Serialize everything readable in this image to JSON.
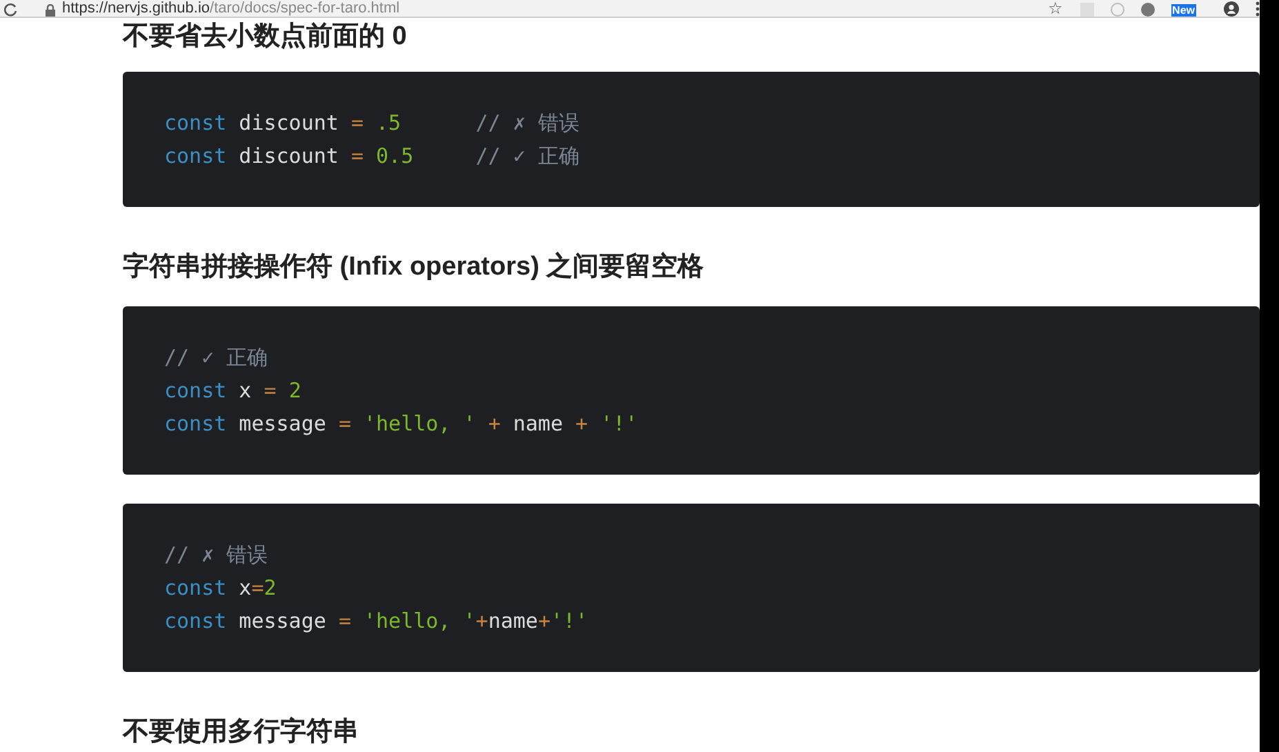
{
  "browser": {
    "url_host": "https://nervjs.github.io",
    "url_path": "/taro/docs/spec-for-taro.html",
    "star": "☆",
    "badge": "New"
  },
  "sections": [
    {
      "heading": "不要省去小数点前面的 0",
      "blocks": [
        {
          "lines": [
            [
              {
                "kind": "keyword",
                "text": "const"
              },
              {
                "kind": "plain",
                "text": " discount "
              },
              {
                "kind": "operator",
                "text": "= "
              },
              {
                "kind": "number",
                "text": ".5"
              },
              {
                "kind": "comment",
                "text": "      // ✗ 错误"
              }
            ],
            [
              {
                "kind": "keyword",
                "text": "const"
              },
              {
                "kind": "plain",
                "text": " discount "
              },
              {
                "kind": "operator",
                "text": "= "
              },
              {
                "kind": "number",
                "text": "0.5"
              },
              {
                "kind": "comment",
                "text": "     // ✓ 正确"
              }
            ]
          ]
        }
      ]
    },
    {
      "heading": "字符串拼接操作符 (Infix operators) 之间要留空格",
      "blocks": [
        {
          "lines": [
            [
              {
                "kind": "comment",
                "text": "// ✓ 正确"
              }
            ],
            [
              {
                "kind": "keyword",
                "text": "const"
              },
              {
                "kind": "plain",
                "text": " x "
              },
              {
                "kind": "operator",
                "text": "= "
              },
              {
                "kind": "number",
                "text": "2"
              }
            ],
            [
              {
                "kind": "keyword",
                "text": "const"
              },
              {
                "kind": "plain",
                "text": " message "
              },
              {
                "kind": "operator",
                "text": "= "
              },
              {
                "kind": "string",
                "text": "'hello, ' "
              },
              {
                "kind": "operator",
                "text": "+"
              },
              {
                "kind": "plain",
                "text": " name "
              },
              {
                "kind": "operator",
                "text": "+ "
              },
              {
                "kind": "string",
                "text": "'!'"
              }
            ]
          ]
        },
        {
          "lines": [
            [
              {
                "kind": "comment",
                "text": "// ✗ 错误"
              }
            ],
            [
              {
                "kind": "keyword",
                "text": "const"
              },
              {
                "kind": "plain",
                "text": " x"
              },
              {
                "kind": "operator",
                "text": "="
              },
              {
                "kind": "number",
                "text": "2"
              }
            ],
            [
              {
                "kind": "keyword",
                "text": "const"
              },
              {
                "kind": "plain",
                "text": " message "
              },
              {
                "kind": "operator",
                "text": "= "
              },
              {
                "kind": "string",
                "text": "'hello, '"
              },
              {
                "kind": "operator",
                "text": "+"
              },
              {
                "kind": "plain",
                "text": "name"
              },
              {
                "kind": "operator",
                "text": "+"
              },
              {
                "kind": "string",
                "text": "'!'"
              }
            ]
          ]
        }
      ]
    },
    {
      "heading": "不要使用多行字符串"
    }
  ]
}
